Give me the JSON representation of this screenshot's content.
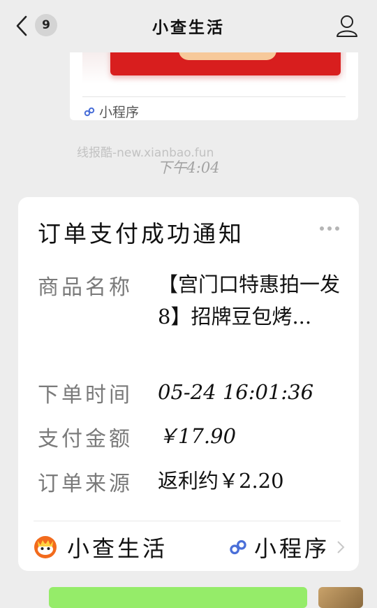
{
  "header": {
    "badge_count": "9",
    "title": "小查生活"
  },
  "prev_card": {
    "mini_program_label": "小程序"
  },
  "watermark": "线报酷-new.xianbao.fun",
  "time": "下午4:04",
  "notification": {
    "title": "订单支付成功通知",
    "rows": [
      {
        "label": "商品名称",
        "value": "【宫门口特惠拍一发8】招牌豆包烤..."
      },
      {
        "label": "下单时间",
        "value": "05-24 16:01:36"
      },
      {
        "label": "支付金额",
        "value": "￥17.90"
      },
      {
        "label": "订单来源",
        "value": "返利约￥2.20"
      }
    ],
    "footer_name": "小查生活",
    "footer_mini": "小程序"
  },
  "colors": {
    "background": "#ededed",
    "card": "#ffffff",
    "bubble_green": "#95ec69",
    "brand_orange": "#f26b1d"
  },
  "icons": [
    "back-chevron-icon",
    "user-profile-icon",
    "mini-program-icon",
    "more-dots-icon",
    "xiaocha-logo-icon",
    "chevron-right-icon"
  ]
}
